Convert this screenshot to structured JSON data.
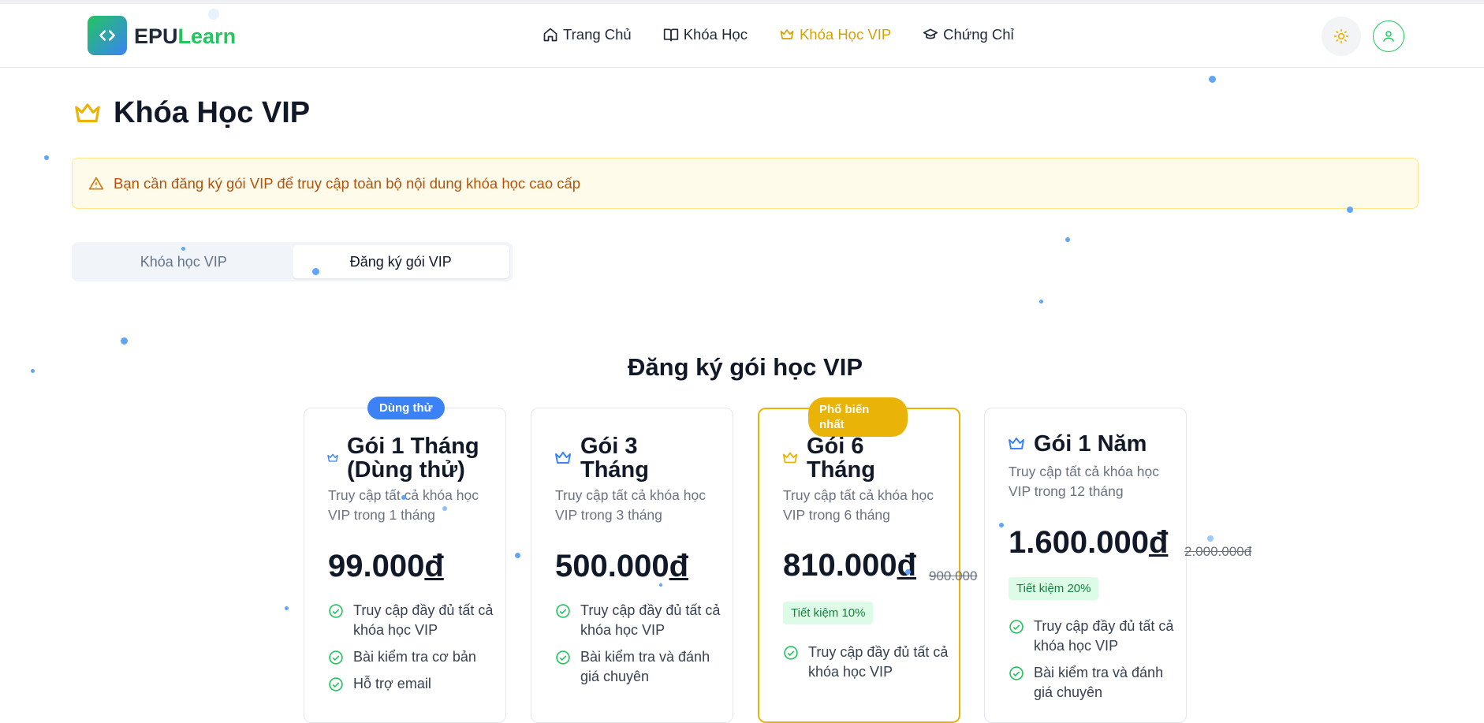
{
  "header": {
    "logo_part1": "EPU",
    "logo_part2": "Learn",
    "nav": [
      {
        "label": "Trang Chủ",
        "icon": "home-icon"
      },
      {
        "label": "Khóa Học",
        "icon": "book-icon"
      },
      {
        "label": "Khóa Học VIP",
        "icon": "crown-icon",
        "active": true
      },
      {
        "label": "Chứng Chỉ",
        "icon": "graduation-cap-icon"
      }
    ],
    "theme_icon": "sun-icon",
    "user_icon": "user-icon"
  },
  "page": {
    "title": "Khóa Học VIP",
    "alert": "Bạn cần đăng ký gói VIP để truy cập toàn bộ nội dung khóa học cao cấp",
    "tabs": [
      {
        "label": "Khóa học VIP",
        "active": false
      },
      {
        "label": "Đăng ký gói VIP",
        "active": true
      }
    ],
    "section_title": "Đăng ký gói học VIP"
  },
  "plans": [
    {
      "badge": "Dùng thử",
      "name": "Gói 1 Tháng (Dùng thử)",
      "desc": "Truy cập tất cả khóa học VIP trong 1 tháng",
      "price": "99.000",
      "currency": "đ",
      "features": [
        "Truy cập đầy đủ tất cả khóa học VIP",
        "Bài kiểm tra cơ bản",
        "Hỗ trợ email"
      ]
    },
    {
      "name": "Gói 3 Tháng",
      "desc": "Truy cập tất cả khóa học VIP trong 3 tháng",
      "price": "500.000",
      "currency": "đ",
      "features": [
        "Truy cập đầy đủ tất cả khóa học VIP",
        "Bài kiểm tra và đánh giá chuyên"
      ]
    },
    {
      "badge": "Phổ biến nhất",
      "name": "Gói 6 Tháng",
      "desc": "Truy cập tất cả khóa học VIP trong 6 tháng",
      "price": "810.000",
      "currency": "đ",
      "old_price": "900.000",
      "save": "Tiết kiệm 10%",
      "features": [
        "Truy cập đầy đủ tất cả khóa học VIP"
      ]
    },
    {
      "name": "Gói 1 Năm",
      "desc": "Truy cập tất cả khóa học VIP trong 12 tháng",
      "price": "1.600.000",
      "currency": "đ",
      "old_price": "2.000.000đ",
      "save": "Tiết kiệm 20%",
      "features": [
        "Truy cập đầy đủ tất cả khóa học VIP",
        "Bài kiểm tra và đánh giá chuyên"
      ]
    }
  ],
  "colors": {
    "vip_gold": "#eab308",
    "primary_blue": "#3b82f6",
    "success_green": "#22c55e",
    "alert_text": "#b45309"
  }
}
